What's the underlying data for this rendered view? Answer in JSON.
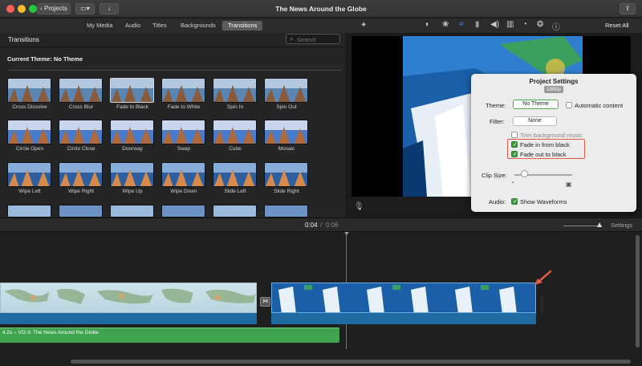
{
  "window": {
    "title": "The News Around the Globe",
    "projects_label": "Projects"
  },
  "tabs": [
    {
      "label": "My Media",
      "active": false
    },
    {
      "label": "Audio",
      "active": false
    },
    {
      "label": "Titles",
      "active": false
    },
    {
      "label": "Backgrounds",
      "active": false
    },
    {
      "label": "Transitions",
      "active": true
    }
  ],
  "browser": {
    "header": "Transitions",
    "search_placeholder": "Search",
    "theme_label": "Current Theme: No Theme",
    "items": [
      "Cross Dissolve",
      "Cross Blur",
      "Fade to Black",
      "Fade to White",
      "Spin In",
      "Spin Out",
      "Circle Open",
      "Circle Close",
      "Doorway",
      "Swap",
      "Cube",
      "Mosaic",
      "Wipe Left",
      "Wipe Right",
      "Wipe Up",
      "Wipe Down",
      "Slide Left",
      "Slide Right"
    ]
  },
  "viewer": {
    "reset_label": "Reset All"
  },
  "project_settings": {
    "title": "Project Settings",
    "resolution": "1080p",
    "theme_label": "Theme:",
    "theme_value": "No Theme",
    "automatic_content": "Automatic content",
    "filter_label": "Filter:",
    "filter_value": "None",
    "trim_music": "Trim background music",
    "fade_in": "Fade in from black",
    "fade_out": "Fade out to black",
    "clip_size_label": "Clip Size:",
    "audio_label": "Audio:",
    "show_waveforms": "Show Waveforms"
  },
  "playback": {
    "current": "0:04",
    "separator": "/",
    "total": "0:06",
    "settings_label": "Settings"
  },
  "timeline": {
    "audio_clip_label": "4.2s – VO-3: The News Around the Globe"
  },
  "colors": {
    "accent_green": "#3c9a3f",
    "highlight_red": "#e05a45",
    "selected_tab": "#5b5b5b"
  }
}
